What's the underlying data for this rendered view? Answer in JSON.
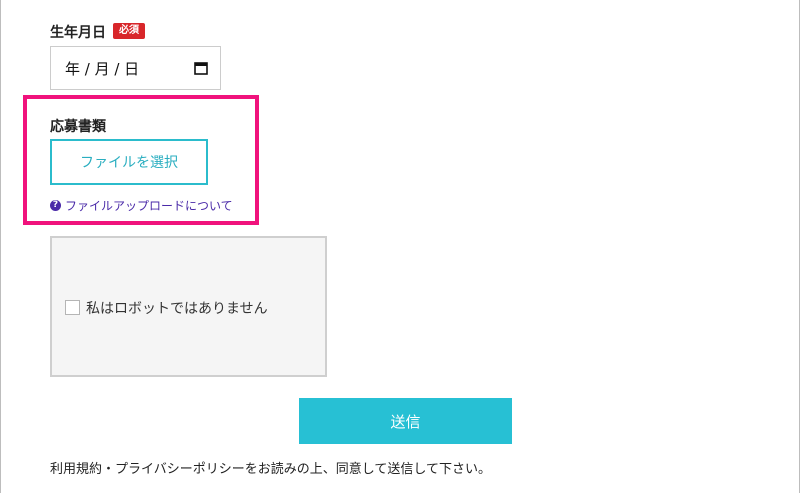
{
  "birthdate": {
    "label": "生年月日",
    "required_badge": "必須",
    "date_display": "年 / 月 / 日"
  },
  "application_docs": {
    "label": "応募書類",
    "file_button": "ファイルを選択",
    "help_link": "ファイルアップロードについて",
    "help_icon": "?"
  },
  "captcha": {
    "checkbox_label": "私はロボットではありません"
  },
  "submit": {
    "label": "送信"
  },
  "terms_note": "利用規約・プライバシーポリシーをお読みの上、同意して送信して下さい。",
  "colors": {
    "required": "#d8262a",
    "highlight": "#f0127c",
    "accent": "#27c0d4",
    "link": "#4a2aa8"
  },
  "icons": {
    "date_picker": "calendar-icon",
    "help": "question-circle-icon"
  }
}
